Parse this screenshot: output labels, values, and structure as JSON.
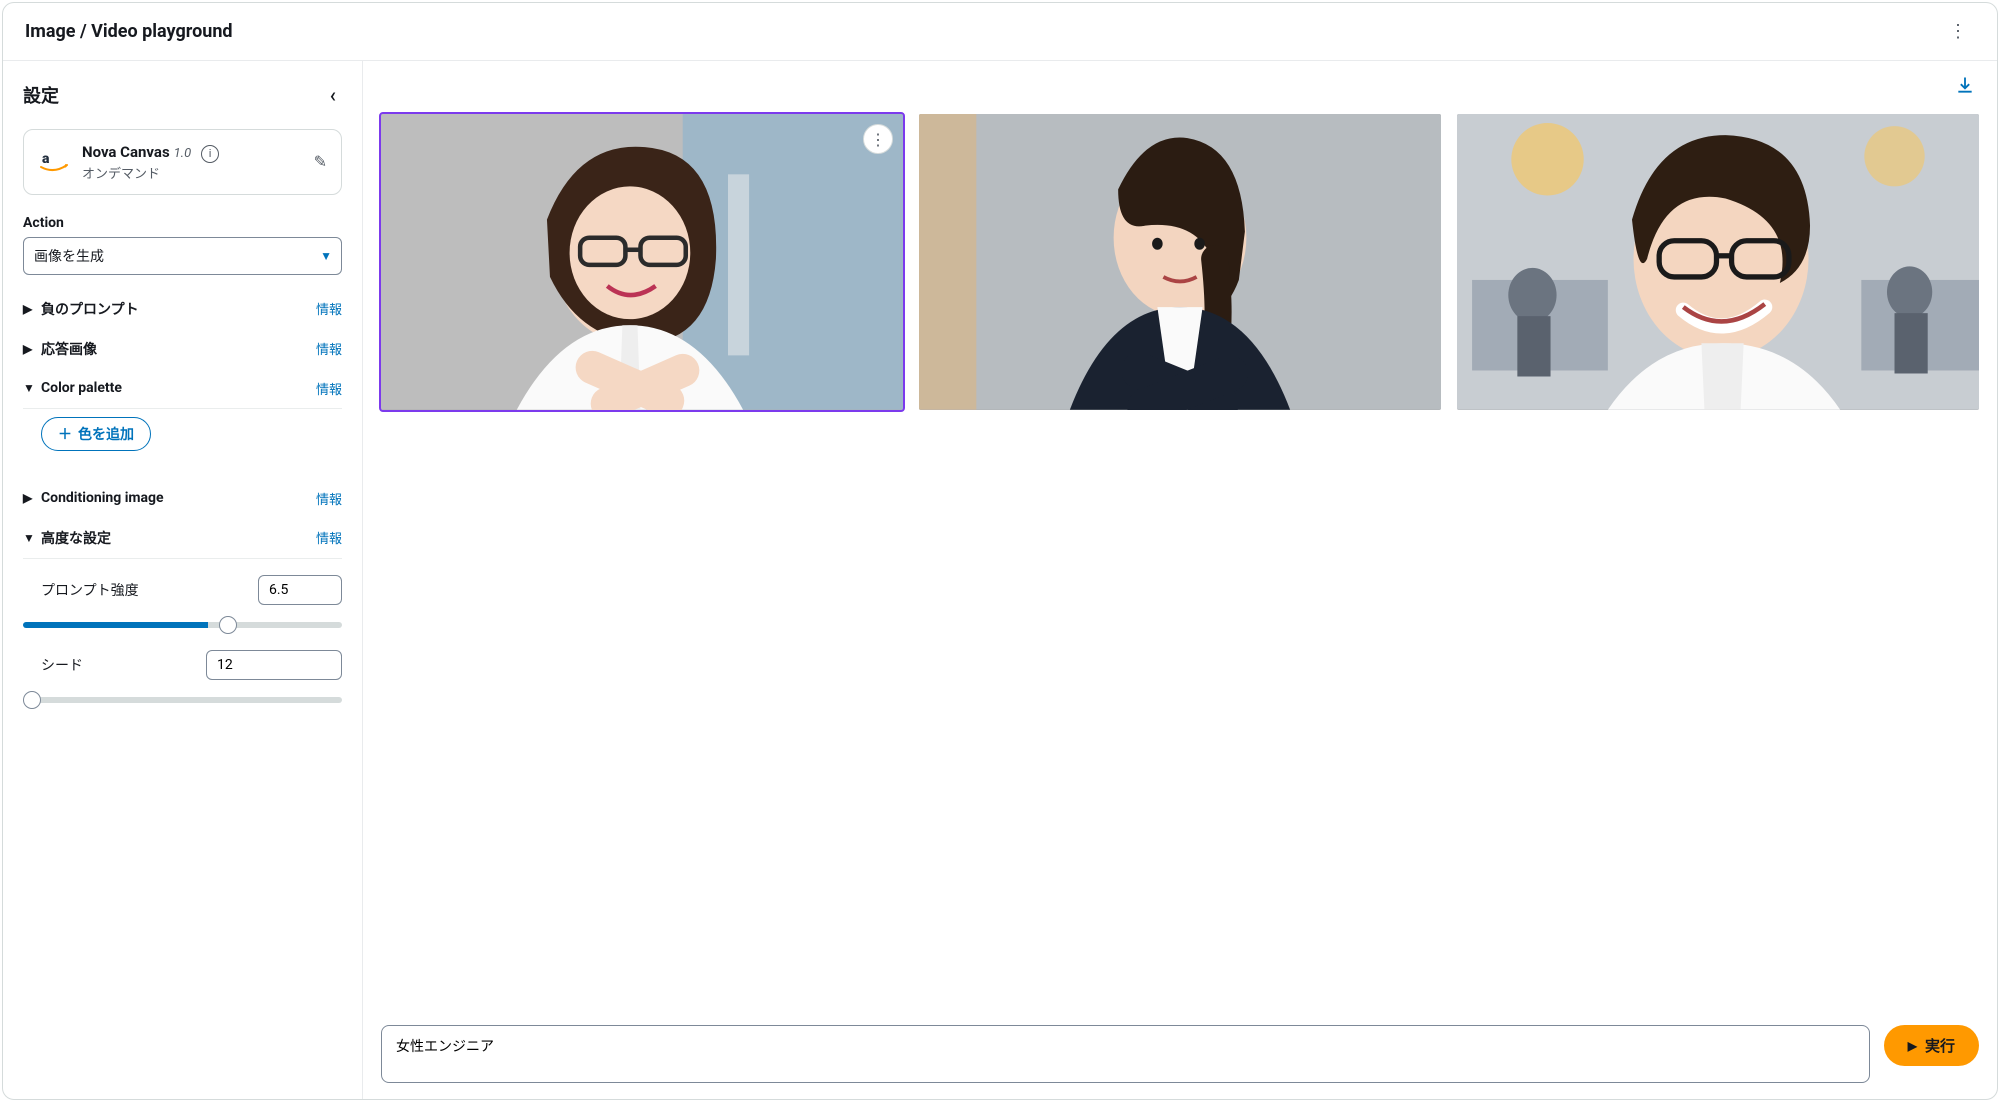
{
  "header": {
    "title": "Image / Video playground"
  },
  "sidebar": {
    "title": "設定",
    "model": {
      "name": "Nova Canvas",
      "version": "1.0",
      "subtitle": "オンデマンド"
    },
    "action": {
      "label": "Action",
      "selected": "画像を生成"
    },
    "sections": {
      "negative_prompt": {
        "label": "負のプロンプト",
        "info": "情報"
      },
      "response_image": {
        "label": "応答画像",
        "info": "情報"
      },
      "color_palette": {
        "label": "Color palette",
        "info": "情報",
        "add_button": "色を追加"
      },
      "conditioning_image": {
        "label": "Conditioning image",
        "info": "情報"
      },
      "advanced": {
        "label": "高度な設定",
        "info": "情報",
        "prompt_strength": {
          "label": "プロンプト強度",
          "value": "6.5"
        },
        "seed": {
          "label": "シード",
          "value": "12"
        }
      }
    }
  },
  "prompt": {
    "value": "女性エンジニア"
  },
  "run_button": "実行"
}
